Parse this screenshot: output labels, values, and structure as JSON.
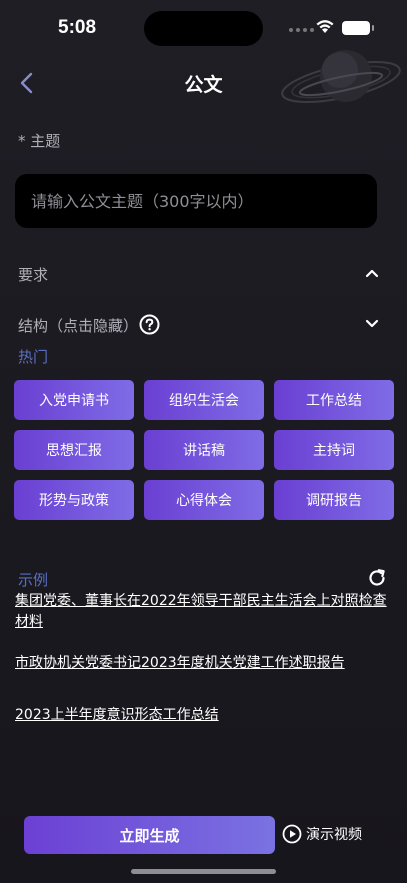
{
  "status": {
    "time": "5:08"
  },
  "nav": {
    "title": "公文"
  },
  "topic": {
    "label": "* 主题",
    "placeholder": "请输入公文主题（300字以内）"
  },
  "requirements": {
    "label": "要求"
  },
  "structure": {
    "label": "结构（点击隐藏）"
  },
  "hot": {
    "label": "热门",
    "tags": [
      "入党申请书",
      "组织生活会",
      "工作总结",
      "思想汇报",
      "讲话稿",
      "主持词",
      "形势与政策",
      "心得体会",
      "调研报告"
    ]
  },
  "examples": {
    "label": "示例",
    "items": [
      "集团党委、董事长在2022年领导干部民主生活会上对照检查材料",
      "市政协机关党委书记2023年度机关党建工作述职报告",
      "2023上半年度意识形态工作总结"
    ]
  },
  "actions": {
    "generate": "立即生成",
    "demo": "演示视频"
  },
  "colors": {
    "accent_start": "#6a3fd2",
    "accent_end": "#7f6ce6",
    "section_label": "#5a6fc2"
  }
}
